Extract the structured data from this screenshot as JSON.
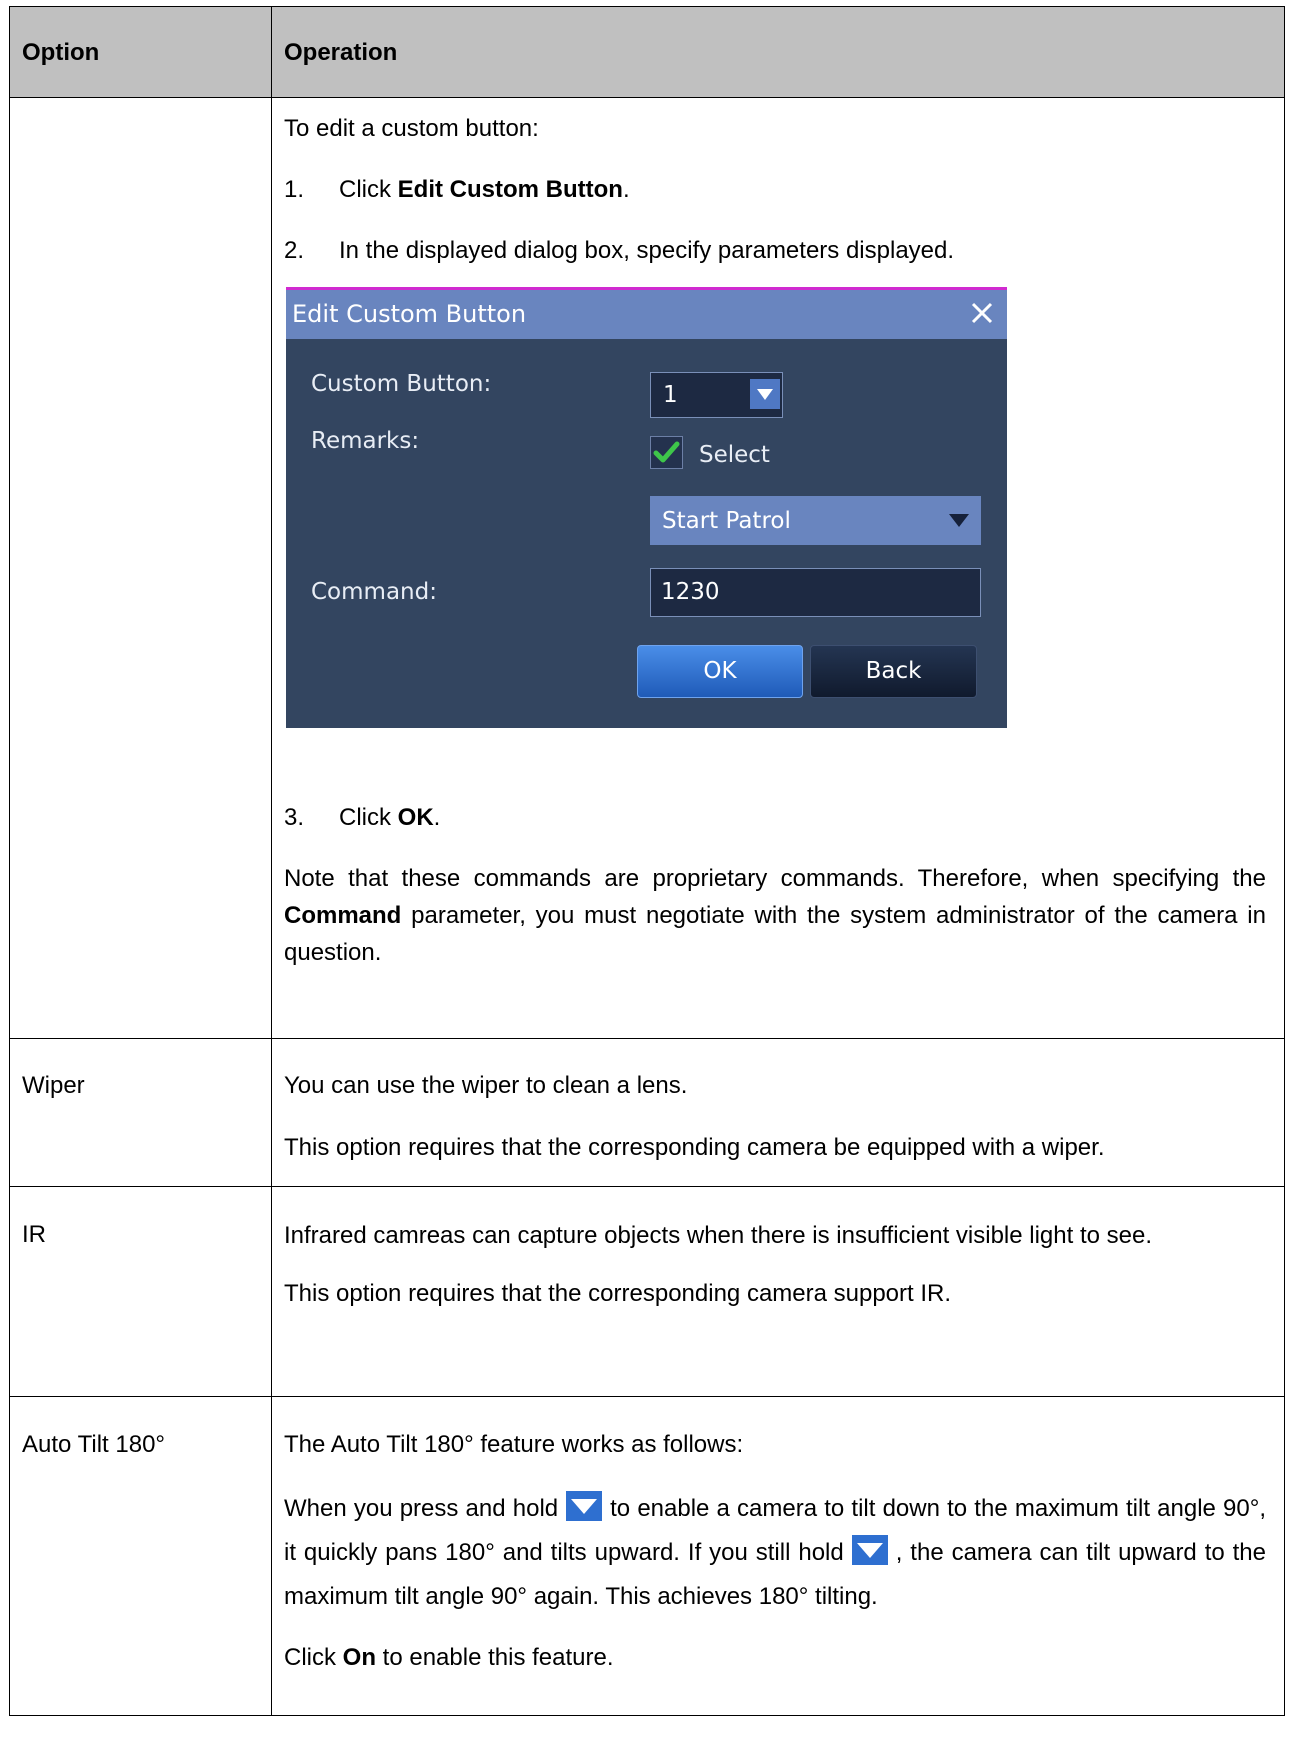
{
  "table": {
    "headers": {
      "option": "Option",
      "operation": "Operation"
    },
    "row1": {
      "intro": "To edit a custom button:",
      "step1_num": "1.",
      "step1_pre": "Click ",
      "step1_bold": "Edit Custom Button",
      "step1_post": ".",
      "step2_num": "2.",
      "step2_text": "In the displayed dialog box, specify parameters displayed.",
      "step3_num": "3.",
      "step3_pre": "Click ",
      "step3_bold": "OK",
      "step3_post": ".",
      "note_pre": "Note that these commands are proprietary commands. Therefore, when specifying the ",
      "note_bold": "Command",
      "note_post": " parameter, you must negotiate with the system administrator of the camera in question."
    },
    "row2": {
      "option": "Wiper",
      "p1": "You can use the wiper to clean a lens.",
      "p2": "This option requires that the corresponding camera be equipped with a wiper."
    },
    "row3": {
      "option": "IR",
      "p1": "Infrared camreas can capture objects when there is insufficient visible light to see.",
      "p2": "This option requires that the corresponding camera support IR."
    },
    "row4": {
      "option": "Auto Tilt 180°",
      "p1": "The Auto Tilt 180° feature works as follows:",
      "p2_a": "When you press and hold",
      "p2_b": "to enable a camera to tilt down to the maximum tilt angle 90°, it quickly pans 180° and tilts upward. If you still hold",
      "p2_c": ", the camera can tilt upward to the maximum tilt angle 90° again. This achieves 180° tilting.",
      "p3_pre": "Click ",
      "p3_bold": "On",
      "p3_post": " to enable this feature."
    }
  },
  "dialog": {
    "title": "Edit Custom Button",
    "custom_button_label": "Custom Button:",
    "custom_button_value": "1",
    "remarks_label": "Remarks:",
    "select_checkbox_label": "Select",
    "select_checked": true,
    "remarks_value": "Start Patrol",
    "command_label": "Command:",
    "command_value": "1230",
    "ok_label": "OK",
    "back_label": "Back",
    "colors": {
      "titlebar": "#6985bf",
      "body": "#334560",
      "accent_border": "#d02ad0",
      "check": "#3ec64a"
    }
  }
}
